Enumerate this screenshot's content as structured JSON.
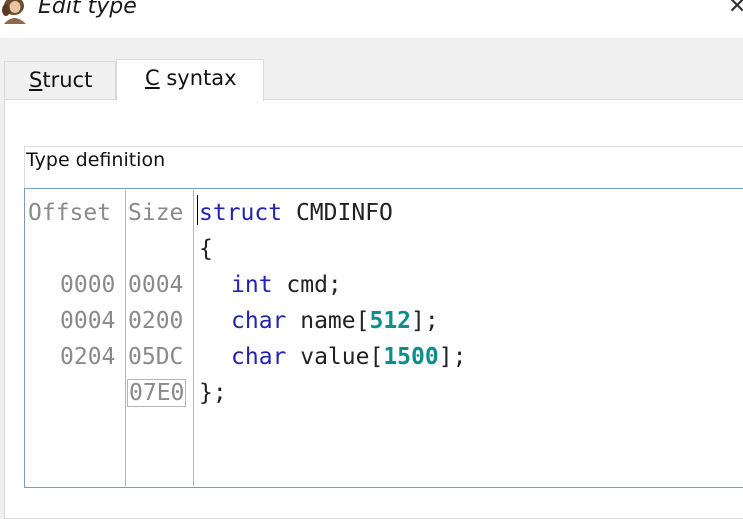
{
  "window": {
    "title": "Edit type",
    "close_glyph": "✕"
  },
  "tabs": [
    {
      "label_mnemonic": "S",
      "label_rest": "truct",
      "active": false
    },
    {
      "label_mnemonic": "C",
      "label_rest": " syntax",
      "active": true
    }
  ],
  "group": {
    "label": "Type definition"
  },
  "editor": {
    "columns": {
      "offset_header": "Offset",
      "size_header": "Size"
    },
    "rows": [
      {
        "offset": "",
        "size": "",
        "keyword": "struct",
        "text": " CMDINFO"
      },
      {
        "offset": "",
        "size": "",
        "text": "{"
      },
      {
        "offset": "0000",
        "size": "0004",
        "keyword": "int",
        "text": " cmd;"
      },
      {
        "offset": "0004",
        "size": "0200",
        "keyword": "char",
        "text": " name[",
        "number": "512",
        "after": "];"
      },
      {
        "offset": "0204",
        "size": "05DC",
        "keyword": "char",
        "text": " value[",
        "number": "1500",
        "after": "];"
      },
      {
        "offset": "",
        "size": "07E0",
        "text": "};"
      }
    ]
  },
  "colors": {
    "keyword": "#2323b0",
    "number": "#0f8c8c",
    "gutter_text": "#8a8a8a",
    "editor_border": "#7a9cc0"
  },
  "icons": {
    "app_icon": "portrait-icon"
  }
}
